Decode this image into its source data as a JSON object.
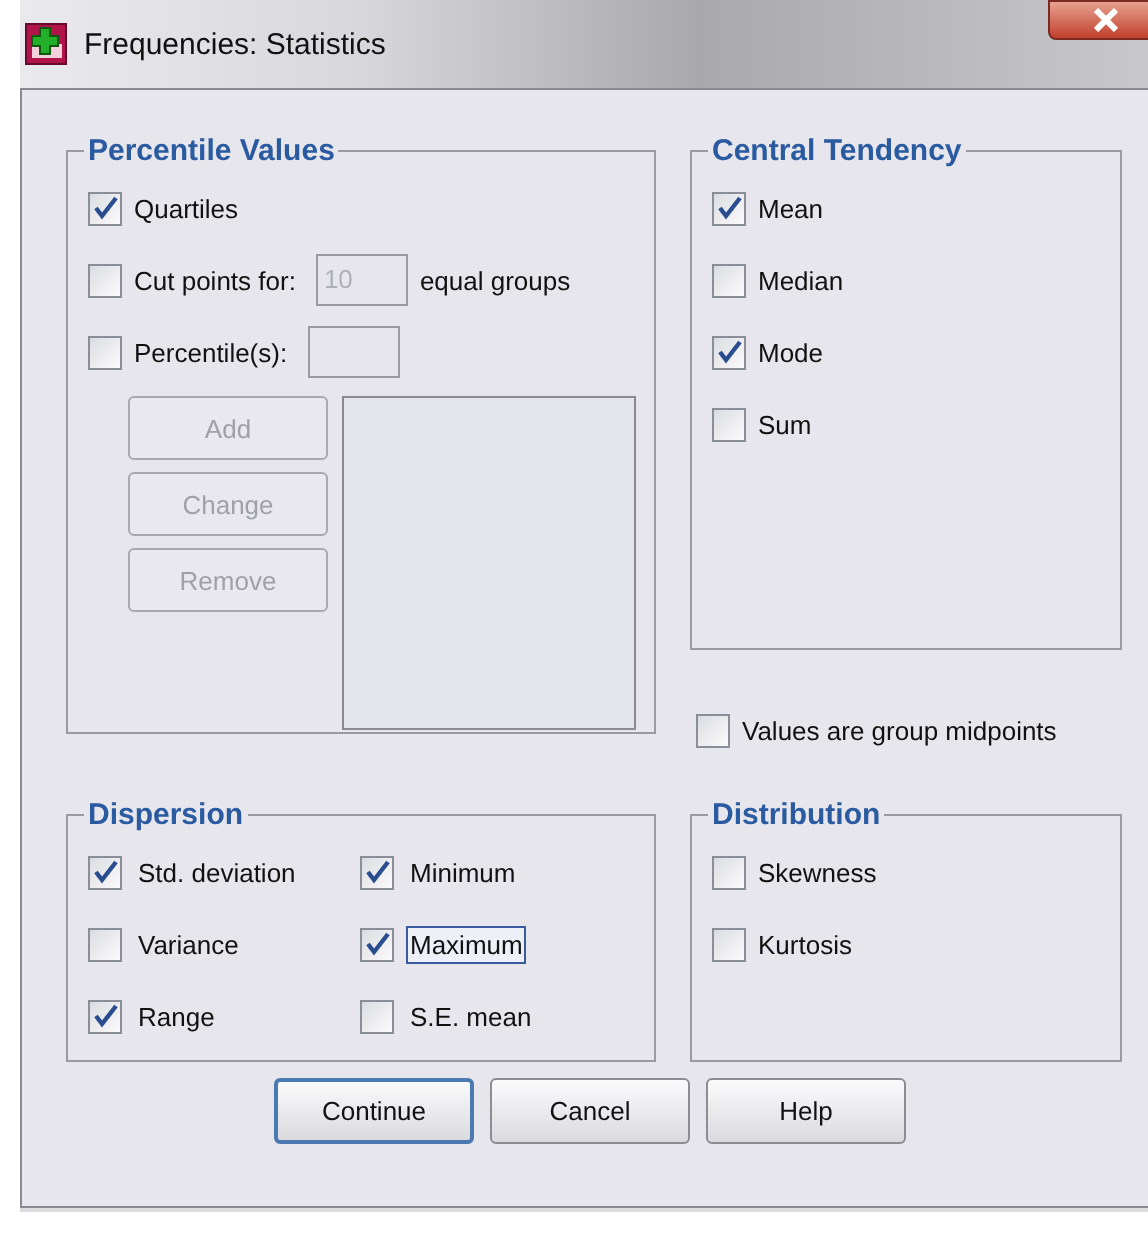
{
  "window": {
    "title": "Frequencies: Statistics"
  },
  "percentile_values": {
    "title": "Percentile Values",
    "options": [
      {
        "label": "Quartiles",
        "checked": true
      },
      {
        "label": "Cut points for:",
        "checked": false,
        "field": {
          "value": "10",
          "disabled": true
        },
        "suffix": "equal groups"
      },
      {
        "label": "Percentile(s):",
        "checked": false,
        "field": {
          "disabled": true
        }
      }
    ],
    "buttons": [
      {
        "label": "Add",
        "disabled": true
      },
      {
        "label": "Change",
        "disabled": true
      },
      {
        "label": "Remove",
        "disabled": true
      }
    ]
  },
  "central_tendency": {
    "title": "Central Tendency",
    "options": [
      {
        "label": "Mean",
        "checked": true
      },
      {
        "label": "Median",
        "checked": false
      },
      {
        "label": "Mode",
        "checked": true
      },
      {
        "label": "Sum",
        "checked": false
      }
    ]
  },
  "group_midpoints": {
    "label": "Values are group midpoints",
    "checked": false
  },
  "dispersion": {
    "title": "Dispersion",
    "options": [
      {
        "label": "Std. deviation",
        "checked": true,
        "focused": false
      },
      {
        "label": "Minimum",
        "checked": true,
        "focused": false
      },
      {
        "label": "Variance",
        "checked": false,
        "focused": false
      },
      {
        "label": "Maximum",
        "checked": true,
        "focused": true
      },
      {
        "label": "Range",
        "checked": true,
        "focused": false
      },
      {
        "label": "S.E. mean",
        "checked": false,
        "focused": false
      }
    ]
  },
  "distribution": {
    "title": "Distribution",
    "options": [
      {
        "label": "Skewness",
        "checked": false
      },
      {
        "label": "Kurtosis",
        "checked": false
      }
    ]
  },
  "buttons": [
    {
      "label": "Continue",
      "default": true
    },
    {
      "label": "Cancel",
      "default": false
    },
    {
      "label": "Help",
      "default": false
    }
  ]
}
